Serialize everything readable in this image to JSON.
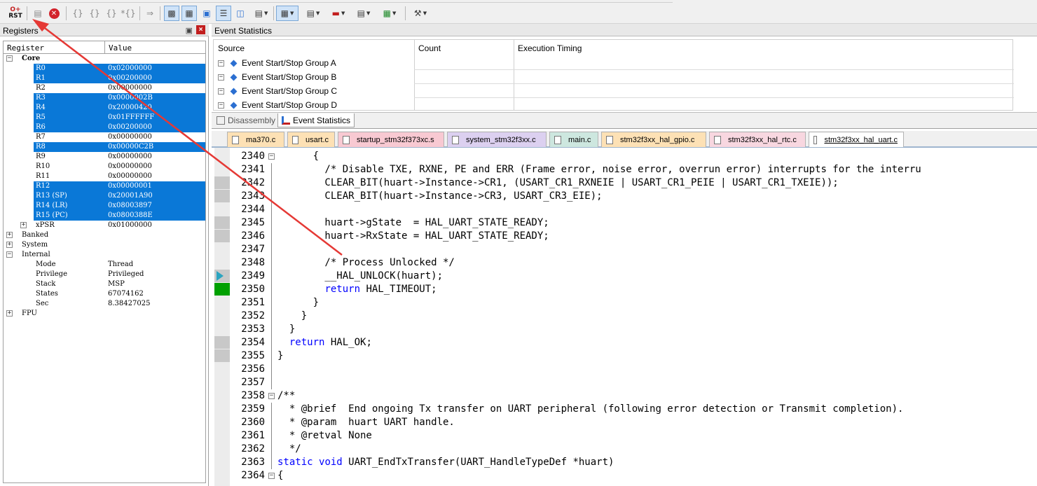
{
  "toolbar": {
    "rst_top": "O+",
    "rst_label": "RST",
    "icons": [
      "reset-icon",
      "run-icon",
      "stop-icon",
      "step-into-icon",
      "step-over-icon",
      "step-out-icon",
      "run-to-cursor-icon",
      "show-next-statement-icon",
      "command-window-icon",
      "disassembly-window-icon",
      "symbols-window-icon",
      "registers-window-icon",
      "call-stack-icon",
      "watch-window-icon",
      "memory-window-icon",
      "serial-window-icon",
      "analysis-window-icon",
      "trace-window-icon",
      "system-viewer-icon",
      "toolbox-icon"
    ]
  },
  "registers": {
    "title": "Registers",
    "col_register": "Register",
    "col_value": "Value",
    "rows": [
      {
        "name": "Core",
        "value": ""
      },
      {
        "name": "R0",
        "value": "0x02000000"
      },
      {
        "name": "R1",
        "value": "0x00200000"
      },
      {
        "name": "R2",
        "value": "0x00000000"
      },
      {
        "name": "R3",
        "value": "0x0000002B"
      },
      {
        "name": "R4",
        "value": "0x20000420"
      },
      {
        "name": "R5",
        "value": "0x01FFFFFF"
      },
      {
        "name": "R6",
        "value": "0x00200000"
      },
      {
        "name": "R7",
        "value": "0x00000000"
      },
      {
        "name": "R8",
        "value": "0x00000C2B"
      },
      {
        "name": "R9",
        "value": "0x00000000"
      },
      {
        "name": "R10",
        "value": "0x00000000"
      },
      {
        "name": "R11",
        "value": "0x00000000"
      },
      {
        "name": "R12",
        "value": "0x00000001"
      },
      {
        "name": "R13 (SP)",
        "value": "0x20001A90"
      },
      {
        "name": "R14 (LR)",
        "value": "0x08003897"
      },
      {
        "name": "R15 (PC)",
        "value": "0x0800388E"
      },
      {
        "name": "xPSR",
        "value": "0x01000000"
      },
      {
        "name": "Banked",
        "value": ""
      },
      {
        "name": "System",
        "value": ""
      },
      {
        "name": "Internal",
        "value": ""
      },
      {
        "name": "Mode",
        "value": "Thread"
      },
      {
        "name": "Privilege",
        "value": "Privileged"
      },
      {
        "name": "Stack",
        "value": "MSP"
      },
      {
        "name": "States",
        "value": "67074162"
      },
      {
        "name": "Sec",
        "value": "8.38427025"
      },
      {
        "name": "FPU",
        "value": ""
      }
    ]
  },
  "event_stats": {
    "title": "Event Statistics",
    "col_source": "Source",
    "col_count": "Count",
    "col_timing": "Execution Timing",
    "groups": [
      "Event Start/Stop Group A",
      "Event Start/Stop Group B",
      "Event Start/Stop Group C",
      "Event Start/Stop Group D"
    ],
    "tabs": [
      "Disassembly",
      "Event Statistics"
    ]
  },
  "file_tabs": [
    {
      "label": "ma370.c",
      "color": "#fde1b5"
    },
    {
      "label": "usart.c",
      "color": "#fde1b5"
    },
    {
      "label": "startup_stm32f373xc.s",
      "color": "#f8c9d2"
    },
    {
      "label": "system_stm32f3xx.c",
      "color": "#dcd0f0"
    },
    {
      "label": "main.c",
      "color": "#cde7df"
    },
    {
      "label": "stm32f3xx_hal_gpio.c",
      "color": "#fde1b5"
    },
    {
      "label": "stm32f3xx_hal_rtc.c",
      "color": "#f8d7e0"
    },
    {
      "label": "stm32f3xx_hal_uart.c",
      "color": "#ffffff"
    }
  ],
  "code": {
    "lines": [
      {
        "n": "2340",
        "t": "      {"
      },
      {
        "n": "2341",
        "t": "        /* Disable TXE, RXNE, PE and ERR (Frame error, noise error, overrun error) interrupts for the interru"
      },
      {
        "n": "2342",
        "t": "        CLEAR_BIT(huart->Instance->CR1, (USART_CR1_RXNEIE | USART_CR1_PEIE | USART_CR1_TXEIE));"
      },
      {
        "n": "2343",
        "t": "        CLEAR_BIT(huart->Instance->CR3, USART_CR3_EIE);"
      },
      {
        "n": "2344",
        "t": ""
      },
      {
        "n": "2345",
        "t": "        huart->gState  = HAL_UART_STATE_READY;"
      },
      {
        "n": "2346",
        "t": "        huart->RxState = HAL_UART_STATE_READY;"
      },
      {
        "n": "2347",
        "t": ""
      },
      {
        "n": "2348",
        "t": "        /* Process Unlocked */"
      },
      {
        "n": "2349",
        "t": "        __HAL_UNLOCK(huart);"
      },
      {
        "n": "2350",
        "t": "        return HAL_TIMEOUT;"
      },
      {
        "n": "2351",
        "t": "      }"
      },
      {
        "n": "2352",
        "t": "    }"
      },
      {
        "n": "2353",
        "t": "  }"
      },
      {
        "n": "2354",
        "t": "  return HAL_OK;"
      },
      {
        "n": "2355",
        "t": "}"
      },
      {
        "n": "2356",
        "t": ""
      },
      {
        "n": "2357",
        "t": ""
      },
      {
        "n": "2358",
        "t": "/**"
      },
      {
        "n": "2359",
        "t": "  * @brief  End ongoing Tx transfer on UART peripheral (following error detection or Transmit completion)."
      },
      {
        "n": "2360",
        "t": "  * @param  huart UART handle."
      },
      {
        "n": "2361",
        "t": "  * @retval None"
      },
      {
        "n": "2362",
        "t": "  */"
      },
      {
        "n": "2363",
        "t": "static void UART_EndTxTransfer(UART_HandleTypeDef *huart)"
      },
      {
        "n": "2364",
        "t": "{"
      }
    ]
  },
  "colors": {
    "selection": "#0a78d7",
    "comment": "#008000",
    "keyword": "#0000ff",
    "annotation_arrow": "#e53935"
  }
}
